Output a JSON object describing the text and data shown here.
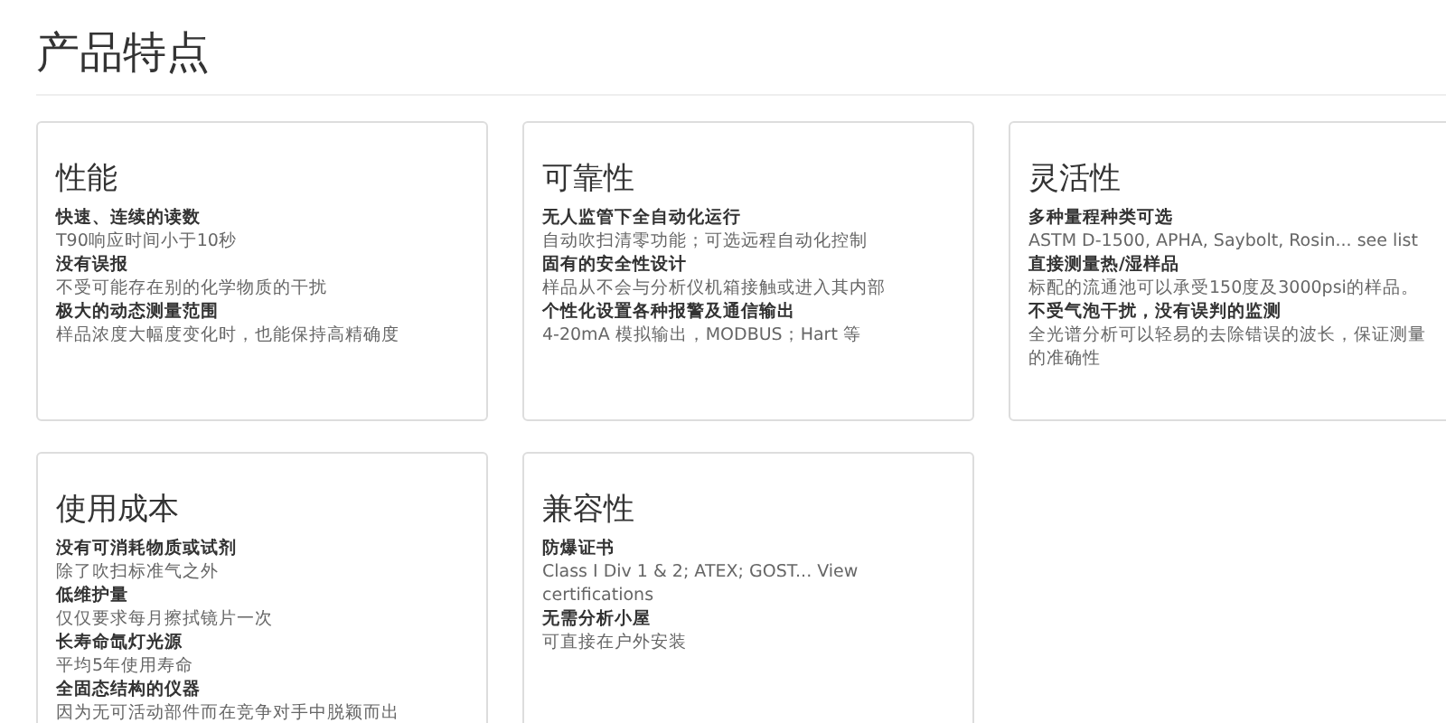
{
  "page_title": "产品特点",
  "cards": [
    {
      "title": "性能",
      "items": [
        {
          "heading": "快速、连续的读数",
          "text": "T90响应时间小于10秒"
        },
        {
          "heading": "没有误报",
          "text": "不受可能存在别的化学物质的干扰"
        },
        {
          "heading": "极大的动态测量范围",
          "text": "样品浓度大幅度变化时，也能保持高精确度"
        }
      ]
    },
    {
      "title": "可靠性",
      "items": [
        {
          "heading": "无人监管下全自动化运行",
          "text": "自动吹扫清零功能；可选远程自动化控制"
        },
        {
          "heading": "固有的安全性设计",
          "text": "样品从不会与分析仪机箱接触或进入其内部"
        },
        {
          "heading": "个性化设置各种报警及通信输出",
          "text": "4-20mA 模拟输出，MODBUS；Hart 等"
        }
      ]
    },
    {
      "title": "灵活性",
      "items": [
        {
          "heading": "多种量程种类可选",
          "text": "ASTM D-1500, APHA, Saybolt, Rosin... see list"
        },
        {
          "heading": "直接测量热/湿样品",
          "text": "标配的流通池可以承受150度及3000psi的样品。"
        },
        {
          "heading": "不受气泡干扰，没有误判的监测",
          "text": "全光谱分析可以轻易的去除错误的波长，保证测量的准确性"
        }
      ]
    },
    {
      "title": "使用成本",
      "items": [
        {
          "heading": "没有可消耗物质或试剂",
          "text": "除了吹扫标准气之外"
        },
        {
          "heading": "低维护量",
          "text": "仅仅要求每月擦拭镜片一次"
        },
        {
          "heading": "长寿命氙灯光源",
          "text": "平均5年使用寿命"
        },
        {
          "heading": "全固态结构的仪器",
          "text": "因为无可活动部件而在竞争对手中脱颖而出"
        }
      ]
    },
    {
      "title": "兼容性",
      "items": [
        {
          "heading": "防爆证书",
          "text": "Class I Div 1 & 2; ATEX; GOST... View certifications"
        },
        {
          "heading": "无需分析小屋",
          "text": "可直接在户外安装"
        }
      ]
    }
  ]
}
